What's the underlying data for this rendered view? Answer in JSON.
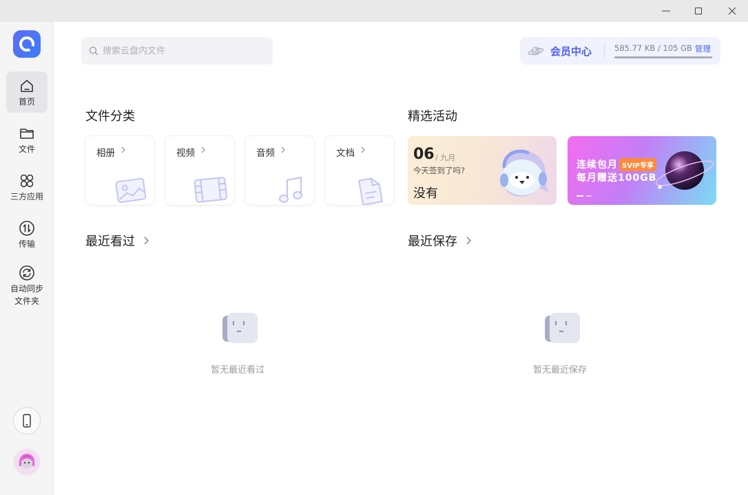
{
  "window": {
    "controls": [
      "minimize",
      "maximize",
      "close"
    ]
  },
  "sidebar": {
    "logo": "app-logo-icon",
    "items": [
      {
        "label": "首页",
        "icon": "home-icon",
        "active": true
      },
      {
        "label": "文件",
        "icon": "folder-icon",
        "active": false
      },
      {
        "label": "三方应用",
        "icon": "apps-grid-icon",
        "active": false
      },
      {
        "label": "传输",
        "icon": "transfer-icon",
        "active": false
      },
      {
        "label": "自动同步\n文件夹",
        "line1": "自动同步",
        "line2": "文件夹",
        "icon": "sync-icon",
        "active": false
      }
    ],
    "bottom": [
      "phone-icon",
      "avatar"
    ]
  },
  "search": {
    "placeholder": "搜索云盘内文件"
  },
  "vip": {
    "title": "会员中心",
    "storage": "585.77 KB / 105 GB",
    "manage": "管理",
    "usage_fraction": 5.3e-06
  },
  "file_category": {
    "title": "文件分类",
    "items": [
      {
        "label": "相册",
        "icon": "photo-icon"
      },
      {
        "label": "视频",
        "icon": "film-icon"
      },
      {
        "label": "音频",
        "icon": "music-icon"
      },
      {
        "label": "文档",
        "icon": "document-icon"
      }
    ]
  },
  "activities": {
    "title": "精选活动",
    "checkin": {
      "day": "06",
      "month": "/ 九月",
      "question": "今天签到了吗?",
      "answer": "没有"
    },
    "promo": {
      "line1": "连续包月",
      "badge": "SVIP专享",
      "line2": "每月赠送100GB"
    }
  },
  "recent_viewed": {
    "title": "最近看过",
    "empty": "暂无最近看过"
  },
  "recent_saved": {
    "title": "最近保存",
    "empty": "暂无最近保存"
  },
  "colors": {
    "accent": "#5060e8",
    "sidebar_bg": "#f5f5f6",
    "titlebar_bg": "#e9e9e9"
  }
}
